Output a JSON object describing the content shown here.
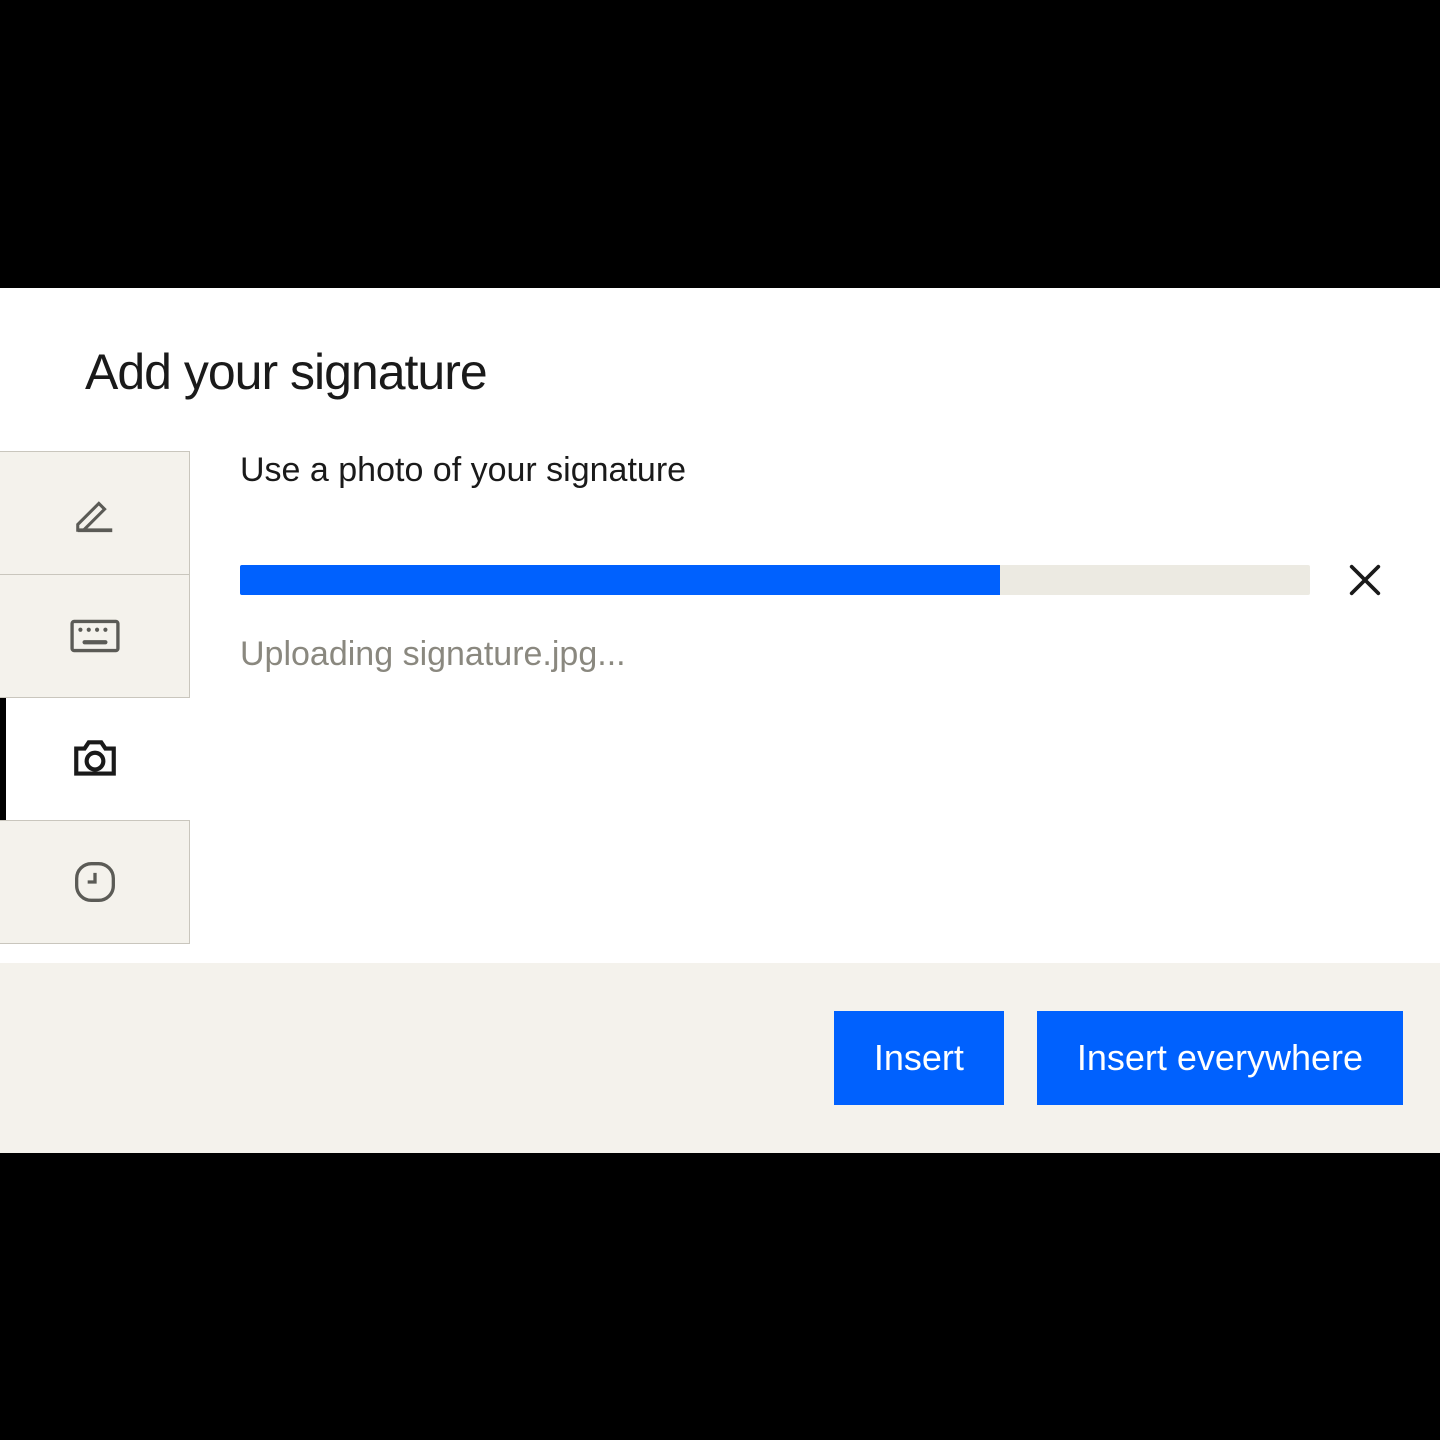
{
  "dialog": {
    "title": "Add your signature",
    "subtitle": "Use a photo of your signature",
    "upload": {
      "progress_percent": 71,
      "status_text": "Uploading signature.jpg..."
    },
    "tabs": {
      "draw": "draw-tab",
      "type": "type-tab",
      "photo": "photo-tab",
      "recent": "recent-tab",
      "active": "photo"
    },
    "footer": {
      "insert_label": "Insert",
      "insert_everywhere_label": "Insert everywhere"
    }
  },
  "colors": {
    "accent": "#0061fe",
    "panel": "#f4f2ec",
    "border": "#c9c6bd",
    "muted_text": "#8a887f"
  }
}
